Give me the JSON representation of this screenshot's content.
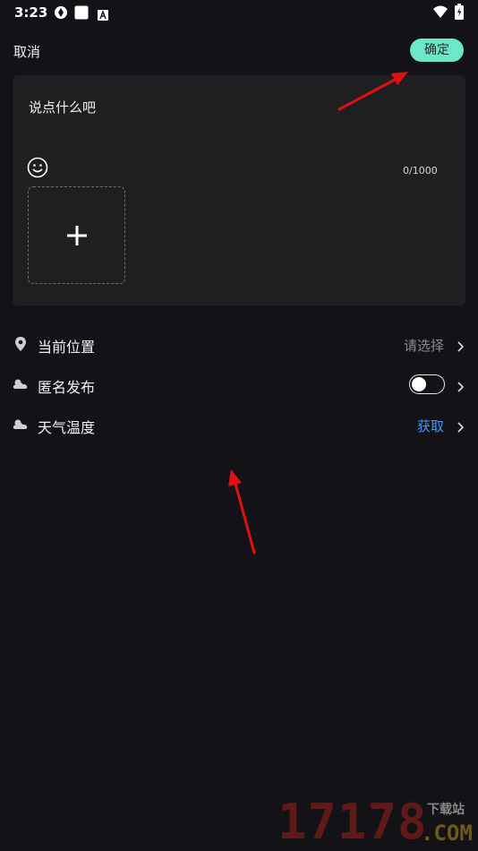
{
  "status_bar": {
    "time": "3:23",
    "icons": [
      "sync-icon",
      "square-icon",
      "a-badge-icon",
      "wifi-icon",
      "battery-icon"
    ]
  },
  "topbar": {
    "cancel_label": "取消",
    "confirm_label": "确定"
  },
  "editor": {
    "placeholder": "说点什么吧",
    "char_count": "0/1000",
    "emoji_icon": "smiley-icon",
    "add_media_icon": "plus-icon"
  },
  "settings": [
    {
      "label": "当前位置",
      "value": "请选择",
      "icon": "location-pin-icon"
    },
    {
      "label": "匿名发布",
      "value": "",
      "icon": "cloud-icon",
      "toggle_on": false
    },
    {
      "label": "天气温度",
      "value": "获取",
      "icon": "cloud-icon"
    }
  ],
  "watermark": {
    "number": "17178",
    "sub": "下载站",
    "domain": ".COM"
  },
  "colors": {
    "background": "#131317",
    "panel": "#1f1f22",
    "confirm": "#6ee6c8",
    "accent": "#3d9bff",
    "annotation": "#e01010"
  }
}
